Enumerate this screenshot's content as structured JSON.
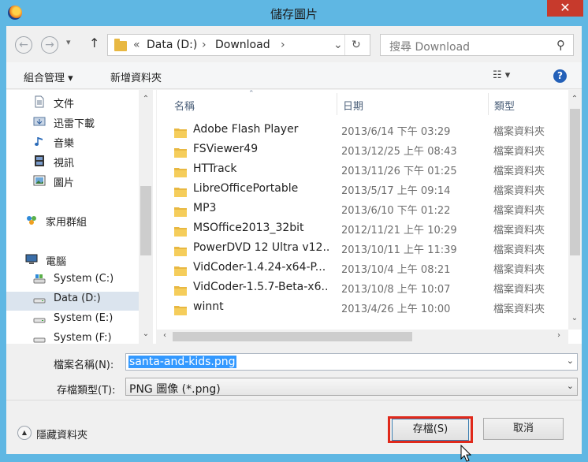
{
  "window": {
    "title": "儲存圖片",
    "close_glyph": "✕"
  },
  "nav": {
    "back_glyph": "←",
    "forward_glyph": "→",
    "recent_glyph": "▾",
    "up_glyph": "↑",
    "address": {
      "overflow": "«",
      "crumbs": [
        "Data (D:)",
        "Download"
      ],
      "separator": "›",
      "dropdown": "⌄",
      "refresh": "↻"
    },
    "search": {
      "placeholder": "搜尋 Download",
      "icon": "⚲"
    }
  },
  "toolbar": {
    "organize": "組合管理 ▾",
    "new_folder": "新增資料夾",
    "view_glyph": "☷ ▾",
    "help_glyph": "?"
  },
  "navpane": {
    "items": [
      {
        "label": "文件",
        "icon": "document-icon"
      },
      {
        "label": "迅雷下載",
        "icon": "download-folder-icon"
      },
      {
        "label": "音樂",
        "icon": "music-icon"
      },
      {
        "label": "視訊",
        "icon": "video-icon"
      },
      {
        "label": "圖片",
        "icon": "picture-icon"
      },
      {
        "label": "家用群組",
        "icon": "homegroup-icon"
      },
      {
        "label": "電腦",
        "icon": "computer-icon"
      },
      {
        "label": "System (C:)",
        "icon": "drive-icon"
      },
      {
        "label": "Data (D:)",
        "icon": "drive-icon",
        "selected": true
      },
      {
        "label": "System (E:)",
        "icon": "drive-icon"
      },
      {
        "label": "System (F:)",
        "icon": "drive-icon"
      }
    ]
  },
  "filelist": {
    "columns": [
      "名稱",
      "日期",
      "類型"
    ],
    "rows": [
      {
        "name": "Adobe Flash Player",
        "date": "2013/6/14 下午 03:29",
        "type": "檔案資料夾"
      },
      {
        "name": "FSViewer49",
        "date": "2013/12/25 上午 08:43",
        "type": "檔案資料夾"
      },
      {
        "name": "HTTrack",
        "date": "2013/11/26 下午 01:25",
        "type": "檔案資料夾"
      },
      {
        "name": "LibreOfficePortable",
        "date": "2013/5/17 上午 09:14",
        "type": "檔案資料夾"
      },
      {
        "name": "MP3",
        "date": "2013/6/10 下午 01:22",
        "type": "檔案資料夾"
      },
      {
        "name": "MSOffice2013_32bit",
        "date": "2012/11/21 上午 10:29",
        "type": "檔案資料夾"
      },
      {
        "name": "PowerDVD 12 Ultra v12....",
        "date": "2013/10/11 上午 11:39",
        "type": "檔案資料夾"
      },
      {
        "name": "VidCoder-1.4.24-x64-P...",
        "date": "2013/10/4 上午 08:21",
        "type": "檔案資料夾"
      },
      {
        "name": "VidCoder-1.5.7-Beta-x6...",
        "date": "2013/10/8 上午 10:07",
        "type": "檔案資料夾"
      },
      {
        "name": "winnt",
        "date": "2013/4/26 上午 10:00",
        "type": "檔案資料夾"
      }
    ]
  },
  "form": {
    "filename_label": "檔案名稱(N):",
    "filename_value": "santa-and-kids.png",
    "filetype_label": "存檔類型(T):",
    "filetype_value": "PNG 圖像 (*.png)"
  },
  "footer": {
    "hide_folders": "隱藏資料夾",
    "save": "存檔(S)",
    "cancel": "取消"
  },
  "colors": {
    "titlebar": "#5fb7e3",
    "close": "#c73a2c",
    "save_highlight": "#e0291b",
    "selection": "#3399ff"
  }
}
